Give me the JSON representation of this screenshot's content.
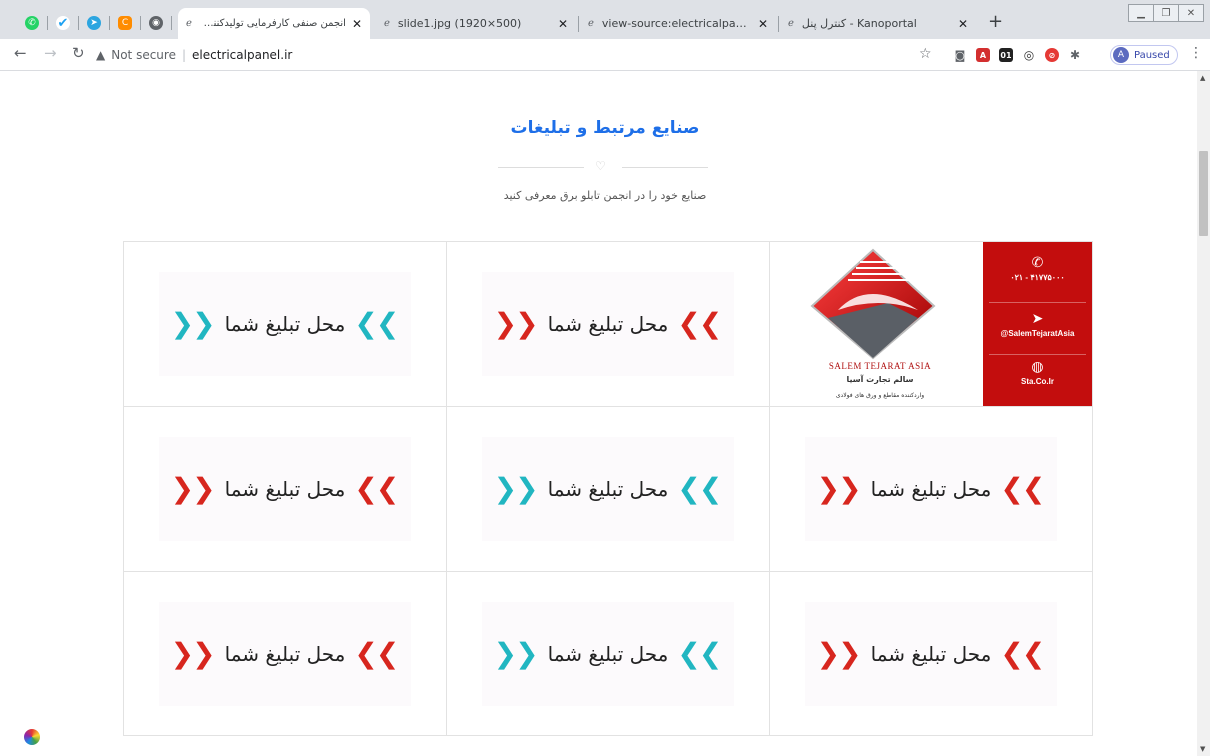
{
  "browser": {
    "tabs": [
      {
        "title": "انجمن صنفی کارفرمایی تولیدکنندگان تابلوهای",
        "active": true
      },
      {
        "title": "slide1.jpg (1920×500)",
        "active": false
      },
      {
        "title": "view-source:electricalpanel.ir",
        "active": false
      },
      {
        "title": "کنترل پنل - Kanoportal",
        "active": false
      }
    ],
    "close_glyph": "✕",
    "newtab_glyph": "+",
    "security_label": "Not secure",
    "url": "electricalpanel.ir",
    "profile_initial": "A",
    "profile_status": "Paused"
  },
  "section": {
    "title": "صنایع مرتبط و تبلیغات",
    "subtitle": "صنایع خود را در انجمن تابلو برق معرفی کنید"
  },
  "featured_ad": {
    "phone": "۰۲۱ - ۴۱۷۷۵۰۰۰",
    "telegram": "@SalemTejaratAsia",
    "website": "Sta.Co.Ir",
    "brand_en": "SALEM TEJARAT ASIA",
    "brand_fa": "سالم تجارت آسیا",
    "tagline_fa": "واردکننده مقاطع و ورق های فولادی"
  },
  "ad_slot_text": "محل تبلیغ شما",
  "ad_slots": [
    {
      "color": "#21b6c1"
    },
    {
      "color": "#d7261e"
    },
    {
      "color": "#d7261e"
    },
    {
      "color": "#21b6c1"
    },
    {
      "color": "#d7261e"
    },
    {
      "color": "#d7261e"
    },
    {
      "color": "#21b6c1"
    },
    {
      "color": "#d7261e"
    }
  ],
  "colors": {
    "title_blue": "#1e6fe8",
    "teal": "#21b6c1",
    "red": "#d7261e",
    "salem_red": "#c30d0d"
  }
}
